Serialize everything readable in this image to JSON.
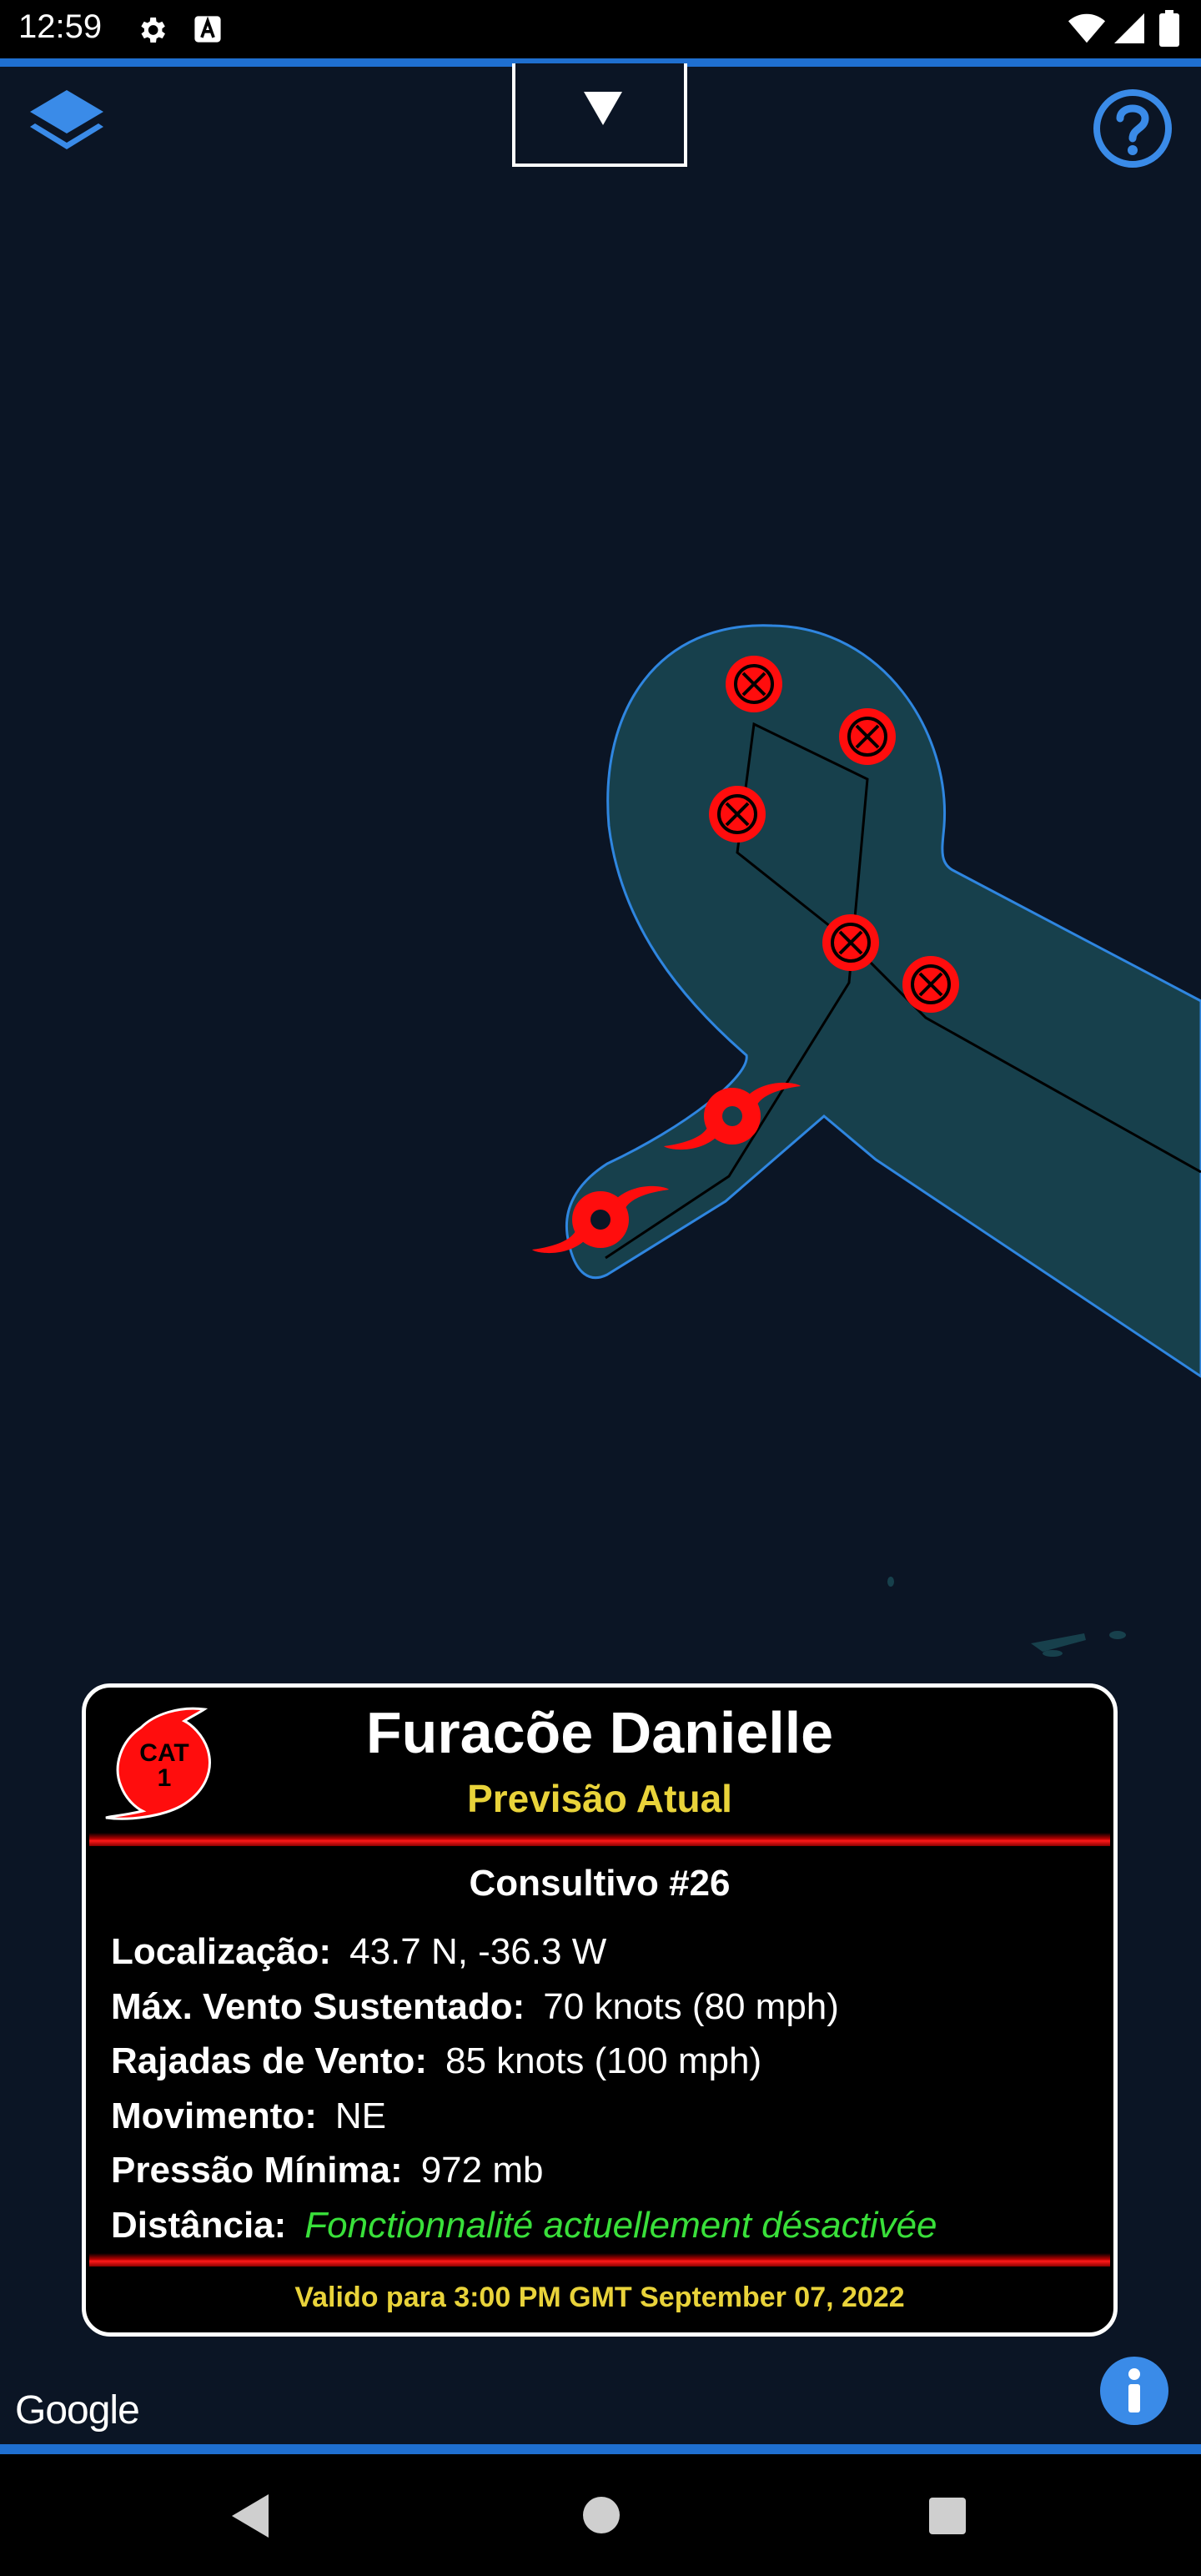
{
  "status_bar": {
    "time": "12:59",
    "icons": [
      "settings-icon",
      "font-a-icon",
      "wifi-icon",
      "signal-icon",
      "battery-icon"
    ]
  },
  "toolbar": {
    "dropdown_glyph": "▼",
    "layers_icon": "layers-icon",
    "help_icon": "help-icon"
  },
  "map": {
    "colors": {
      "background": "#0b1525",
      "cone_fill": "#17404c",
      "cone_border": "#2f86e0",
      "track": "#000000",
      "marker": "#ff0d0d"
    }
  },
  "card": {
    "category_line1": "CAT",
    "category_line2": "1",
    "title": "Furacõe Danielle",
    "subtitle": "Previsão Atual",
    "advisory": "Consultivo #26",
    "rows": [
      {
        "label": "Localização:",
        "value": "43.7 N, -36.3 W"
      },
      {
        "label": "Máx. Vento Sustentado:",
        "value": "70 knots (80 mph)"
      },
      {
        "label": "Rajadas de Vento:",
        "value": "85 knots (100 mph)"
      },
      {
        "label": "Movimento:",
        "value": "NE"
      },
      {
        "label": "Pressão Mínima:",
        "value": "972 mb"
      },
      {
        "label": "Distância:",
        "value": "Fonctionnalité actuellement désactivée"
      }
    ],
    "valid": "Valido para 3:00 PM GMT September 07, 2022"
  },
  "map_footer": {
    "attribution": "Google"
  },
  "nav": {
    "icons": [
      "back-icon",
      "home-icon",
      "recents-icon"
    ]
  }
}
